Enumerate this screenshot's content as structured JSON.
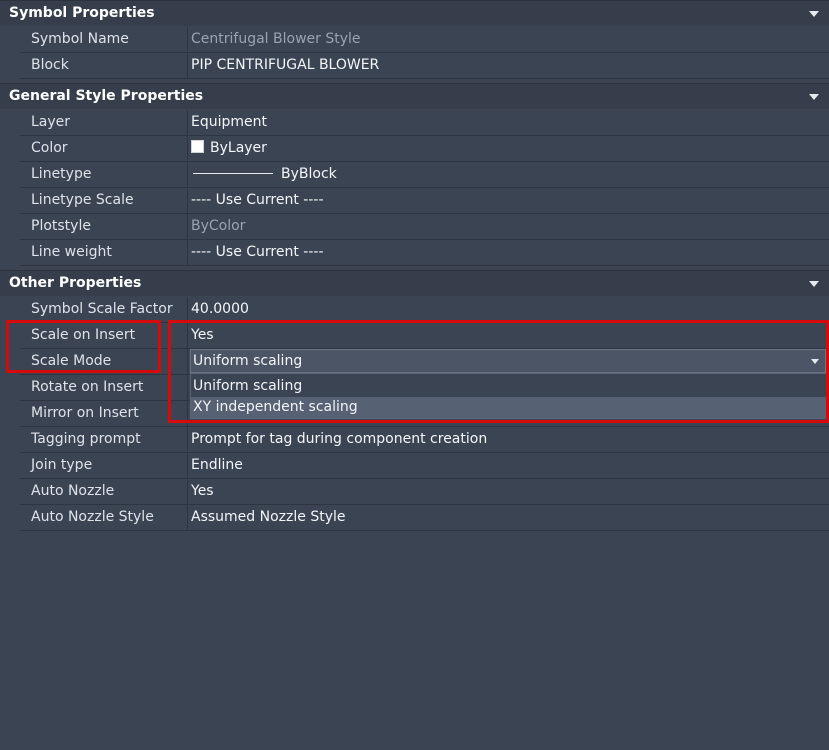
{
  "sections": {
    "symbol": {
      "title": "Symbol Properties",
      "rows": [
        {
          "name": "Symbol Name",
          "value": "Centrifugal Blower Style"
        },
        {
          "name": "Block",
          "value": "PIP CENTRIFUGAL BLOWER"
        }
      ]
    },
    "general": {
      "title": "General Style Properties",
      "rows": [
        {
          "name": "Layer",
          "value": "Equipment"
        },
        {
          "name": "Color",
          "value": "ByLayer"
        },
        {
          "name": "Linetype",
          "value": "ByBlock"
        },
        {
          "name": "Linetype Scale",
          "value": "---- Use Current ----"
        },
        {
          "name": "Plotstyle",
          "value": "ByColor"
        },
        {
          "name": "Line weight",
          "value": "---- Use Current ----"
        }
      ]
    },
    "other": {
      "title": "Other Properties",
      "rows": [
        {
          "name": "Symbol Scale Factor",
          "value": "40.0000"
        },
        {
          "name": "Scale on Insert",
          "value": "Yes"
        },
        {
          "name": "Scale Mode",
          "value": "Uniform scaling"
        },
        {
          "name": "Rotate on Insert",
          "value": ""
        },
        {
          "name": "Mirror on Insert",
          "value": ""
        },
        {
          "name": "Tagging prompt",
          "value": "Prompt for tag during component creation"
        },
        {
          "name": "Join type",
          "value": "Endline"
        },
        {
          "name": "Auto Nozzle",
          "value": "Yes"
        },
        {
          "name": "Auto Nozzle Style",
          "value": "Assumed Nozzle Style"
        }
      ]
    }
  },
  "dropdown": {
    "options": [
      "Uniform scaling",
      "XY independent scaling"
    ],
    "hovered": "XY independent scaling"
  },
  "colors": {
    "background": "#3b4453",
    "header": "#363e4b",
    "highlight": "#d50a0a",
    "hover": "#566173"
  }
}
